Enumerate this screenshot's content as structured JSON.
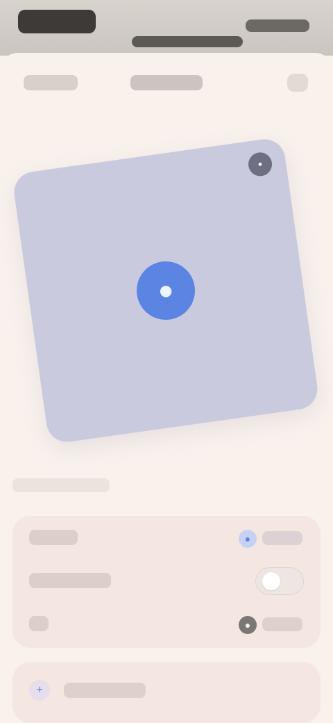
{
  "status_bar": {
    "time": "",
    "icons_label": ""
  },
  "navigation": {
    "back_label": "",
    "title": "",
    "more_label": ""
  },
  "preview": {
    "center_icon": "circle-icon",
    "corner_icon": "dot-icon"
  },
  "section": {
    "title": ""
  },
  "settings": {
    "rows": [
      {
        "label": "",
        "value": "",
        "icon": "blue-dot-icon"
      },
      {
        "label": "",
        "value": "",
        "control": "toggle"
      },
      {
        "label": "",
        "value": "",
        "icon": "dark-dot-icon"
      }
    ]
  },
  "bottom_action": {
    "label": "",
    "icon": "plus-icon"
  },
  "colors": {
    "background": "#f8f1ec",
    "card": "#f4e7e2",
    "preview": "#c9cadd",
    "accent": "#5c84e2"
  }
}
